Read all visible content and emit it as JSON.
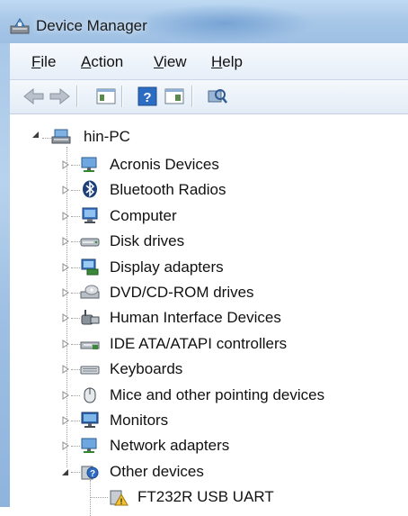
{
  "window": {
    "title": "Device Manager"
  },
  "menu": {
    "file": "F",
    "file_rest": "ile",
    "action": "A",
    "action_rest": "ction",
    "view": "V",
    "view_rest": "iew",
    "help": "H",
    "help_rest": "elp"
  },
  "tree": {
    "root": "hin-PC",
    "categories": [
      {
        "label": "Acronis Devices",
        "icon": "network-device-icon"
      },
      {
        "label": "Bluetooth Radios",
        "icon": "bluetooth-icon"
      },
      {
        "label": "Computer",
        "icon": "computer-icon"
      },
      {
        "label": "Disk drives",
        "icon": "disk-drive-icon"
      },
      {
        "label": "Display adapters",
        "icon": "display-adapter-icon"
      },
      {
        "label": "DVD/CD-ROM drives",
        "icon": "dvd-drive-icon"
      },
      {
        "label": "Human Interface Devices",
        "icon": "hid-icon"
      },
      {
        "label": "IDE ATA/ATAPI controllers",
        "icon": "ide-controller-icon"
      },
      {
        "label": "Keyboards",
        "icon": "keyboard-icon"
      },
      {
        "label": "Mice and other pointing devices",
        "icon": "mouse-icon"
      },
      {
        "label": "Monitors",
        "icon": "monitor-icon"
      },
      {
        "label": "Network adapters",
        "icon": "network-adapter-icon"
      },
      {
        "label": "Other devices",
        "icon": "unknown-device-icon"
      }
    ],
    "child": {
      "label": "FT232R USB UART",
      "icon": "warning-device-icon"
    }
  }
}
